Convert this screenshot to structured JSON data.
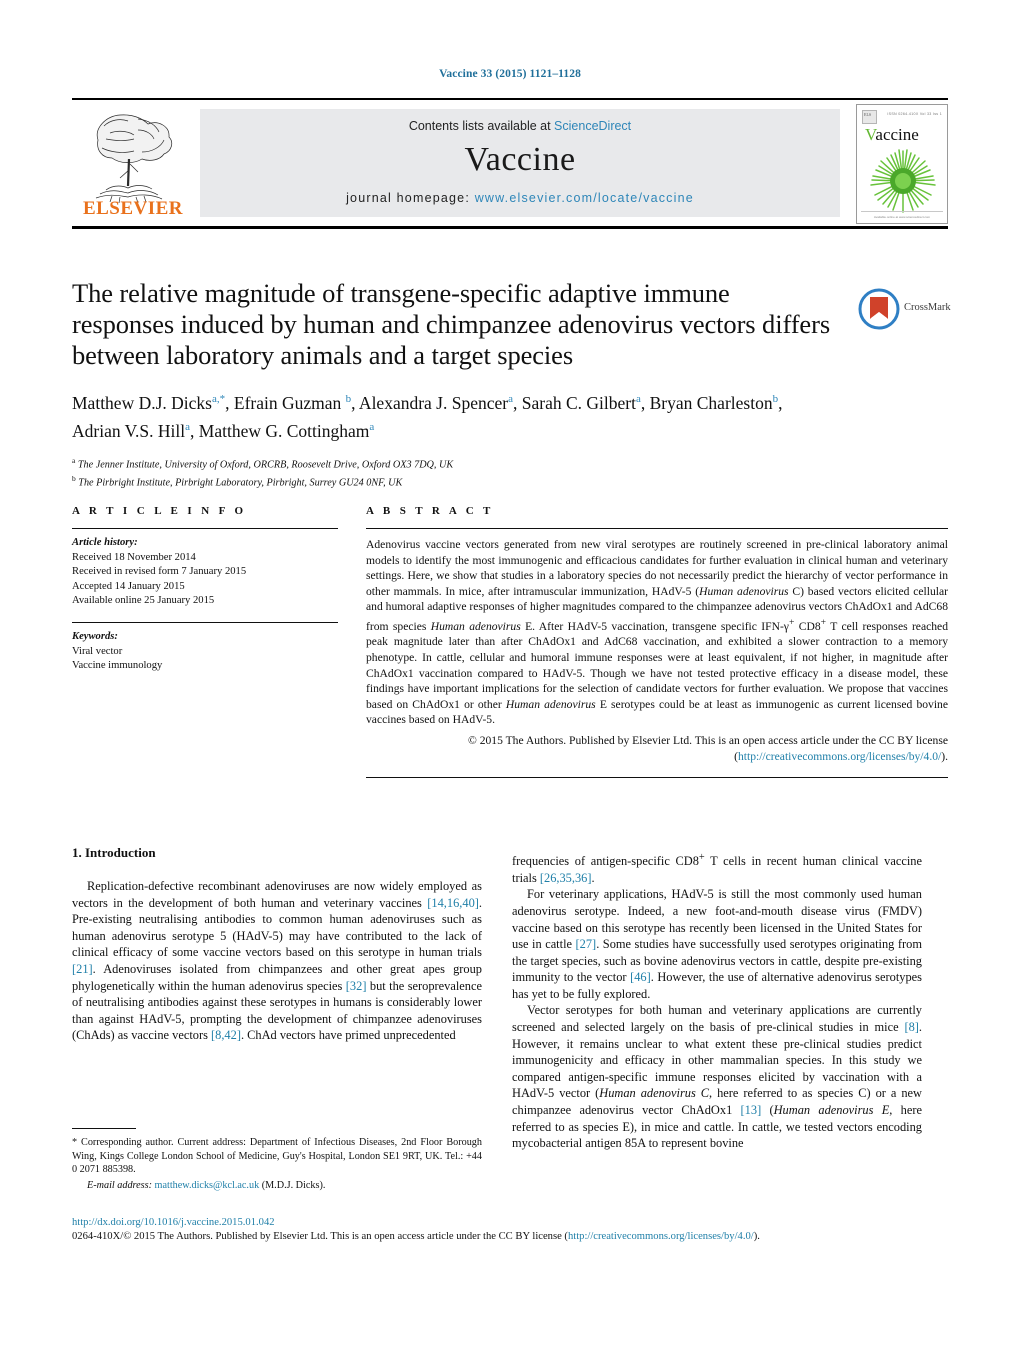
{
  "running_head": "Vaccine 33 (2015) 1121–1128",
  "masthead": {
    "contents_prefix": "Contents lists available at ",
    "contents_link": "ScienceDirect",
    "journal_name": "Vaccine",
    "homepage_prefix": "journal homepage: ",
    "homepage_link": "www.elsevier.com/locate/vaccine",
    "publisher_wordmark": "ELSEVIER",
    "cover": {
      "title": "Vaccine",
      "title_initial": "V",
      "title_rest": "accine",
      "els_mark": "ELS",
      "meta": "ISSN 0264-410X   Vol 33 Iss 1",
      "footer": "Available online at www.sciencedirect.com"
    }
  },
  "article": {
    "title": "The relative magnitude of transgene-specific adaptive immune responses induced by human and chimpanzee adenovirus vectors differs between laboratory animals and a target species",
    "authors_line1": "Matthew D.J. Dicks",
    "authors_html": "Matthew D.J. Dicks<sup>a,*</sup>, Efrain Guzman <sup>b</sup>, Alexandra J. Spencer<sup>a</sup>, Sarah C. Gilbert<sup>a</sup>, Bryan Charleston<sup>b</sup>, Adrian V.S. Hill<sup>a</sup>, Matthew G. Cottingham<sup>a</sup>",
    "affiliation_a": "The Jenner Institute, University of Oxford, ORCRB, Roosevelt Drive, Oxford OX3 7DQ, UK",
    "affiliation_b": "The Pirbright Institute, Pirbright Laboratory, Pirbright, Surrey GU24 0NF, UK",
    "crossmark_label": "CrossMark"
  },
  "article_info": {
    "heading": "A R T I C L E   I N F O",
    "history_label": "Article history:",
    "history": [
      "Received 18 November 2014",
      "Received in revised form 7 January 2015",
      "Accepted 14 January 2015",
      "Available online 25 January 2015"
    ],
    "keywords_label": "Keywords:",
    "keywords": [
      "Viral vector",
      "Vaccine immunology"
    ]
  },
  "abstract": {
    "heading": "A B S T R A C T",
    "paragraph_html": "Adenovirus vaccine vectors generated from new viral serotypes are routinely screened in pre-clinical laboratory animal models to identify the most immunogenic and efficacious candidates for further evaluation in clinical human and veterinary settings. Here, we show that studies in a laboratory species do not necessarily predict the hierarchy of vector performance in other mammals. In mice, after intramuscular immunization, HAdV-5 (<i>Human adenovirus</i> C) based vectors elicited cellular and humoral adaptive responses of higher magnitudes compared to the chimpanzee adenovirus vectors ChAdOx1 and AdC68 from species <i>Human adenovirus</i> E. After HAdV-5 vaccination, transgene specific IFN-γ<sup>+</sup> CD8<sup>+</sup> T cell responses reached peak magnitude later than after ChAdOx1 and AdC68 vaccination, and exhibited a slower contraction to a memory phenotype. In cattle, cellular and humoral immune responses were at least equivalent, if not higher, in magnitude after ChAdOx1 vaccination compared to HAdV-5. Though we have not tested protective efficacy in a disease model, these findings have important implications for the selection of candidate vectors for further evaluation. We propose that vaccines based on ChAdOx1 or other <i>Human adenovirus</i> E serotypes could be at least as immunogenic as current licensed bovine vaccines based on HAdV-5.",
    "copyright_line": "© 2015 The Authors. Published by Elsevier Ltd. This is an open access article under the CC BY license",
    "license_open": "(",
    "license_url": "http://creativecommons.org/licenses/by/4.0/",
    "license_close": ")."
  },
  "body": {
    "section_number_title": "1.  Introduction",
    "left_column_html": "<p class=\"first\">Replication-defective recombinant adenoviruses are now widely employed as vectors in the development of both human and veterinary vaccines <span class=\"ref\">[14,16,40]</span>. Pre-existing neutralising antibodies to common human adenoviruses such as human adenovirus serotype 5 (HAdV-5) may have contributed to the lack of clinical efficacy of some vaccine vectors based on this serotype in human trials <span class=\"ref\">[21]</span>. Adenoviruses isolated from chimpanzees and other great apes group phylogenetically within the human adenovirus species <span class=\"ref\">[32]</span> but the seroprevalence of neutralising antibodies against these serotypes in humans is considerably lower than against HAdV-5, prompting the development of chimpanzee adenoviruses (ChAds) as vaccine vectors <span class=\"ref\">[8,42]</span>. ChAd vectors have primed unprecedented</p>",
    "right_column_html": "<p style=\"text-indent:0\">frequencies of antigen-specific CD8<sup>+</sup> T cells in recent human clinical vaccine trials <span class=\"ref\">[26,35,36]</span>.</p><p>For veterinary applications, HAdV-5 is still the most commonly used human adenovirus serotype. Indeed, a new foot-and-mouth disease virus (FMDV) vaccine based on this serotype has recently been licensed in the United States for use in cattle <span class=\"ref\">[27]</span>. Some studies have successfully used serotypes originating from the target species, such as bovine adenovirus vectors in cattle, despite pre-existing immunity to the vector <span class=\"ref\">[46]</span>. However, the use of alternative adenovirus serotypes has yet to be fully explored.</p><p>Vector serotypes for both human and veterinary applications are currently screened and selected largely on the basis of pre-clinical studies in mice <span class=\"ref\">[8]</span>. However, it remains unclear to what extent these pre-clinical studies predict immunogenicity and efficacy in other mammalian species. In this study we compared antigen-specific immune responses elicited by vaccination with a HAdV-5 vector (<i>Human adenovirus C</i>, here referred to as species C) or a new chimpanzee adenovirus vector ChAdOx1 <span class=\"ref\">[13]</span> (<i>Human adenovirus E</i>, here referred to as species E), in mice and cattle. In cattle, we tested vectors encoding mycobacterial antigen 85A to represent bovine</p>"
  },
  "footnote": {
    "text_html": "* Corresponding author. Current address: Department of Infectious Diseases, 2nd Floor Borough Wing, Kings College London School of Medicine, Guy's Hospital, London SE1 9RT, UK. Tel.: +44 0 2071 885398.",
    "email_label": "E-mail address:",
    "email": "matthew.dicks@kcl.ac.uk",
    "email_suffix": "(M.D.J. Dicks)."
  },
  "bottom": {
    "doi": "http://dx.doi.org/10.1016/j.vaccine.2015.01.042",
    "issn_prefix": "0264-410X/© 2015 The Authors. Published by Elsevier Ltd. This is an open access article under the CC BY license (",
    "issn_link": "http://creativecommons.org/licenses/by/4.0/",
    "issn_suffix": ")."
  },
  "colors": {
    "link": "#1f7fa8",
    "banner_bg": "#e8e9eb",
    "elsevier_orange": "#E9711C",
    "cover_green": "#62b832"
  }
}
